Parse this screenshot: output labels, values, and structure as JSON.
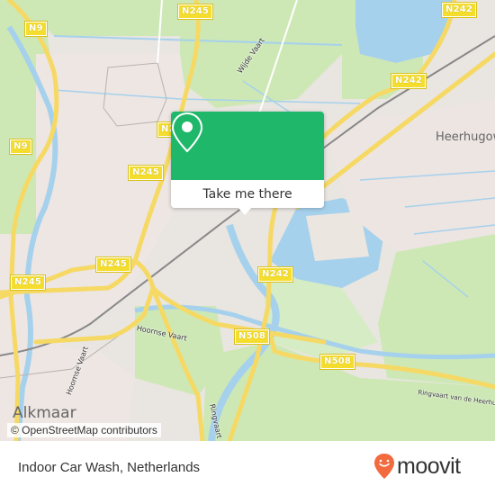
{
  "map": {
    "road_shields": [
      {
        "id": "n245-top",
        "label": "N245"
      },
      {
        "id": "n242-topright",
        "label": "N242"
      },
      {
        "id": "n9-top",
        "label": "N9"
      },
      {
        "id": "n242-mid",
        "label": "N242"
      },
      {
        "id": "n24x-partial",
        "label": "N2"
      },
      {
        "id": "n9-left",
        "label": "N9"
      },
      {
        "id": "n245-mid",
        "label": "N245"
      },
      {
        "id": "n245-left",
        "label": "N245"
      },
      {
        "id": "n245-lower",
        "label": "N245"
      },
      {
        "id": "n242-lower",
        "label": "N242"
      },
      {
        "id": "n508-a",
        "label": "N508"
      },
      {
        "id": "n508-b",
        "label": "N508"
      }
    ],
    "place_labels": {
      "alkmaar": "Alkmaar",
      "heerhugowaard": "Heerhugow"
    },
    "water_labels": {
      "wijde_vaart": "Wijde Vaart",
      "hoornse_vaart_1": "Hoornse Vaart",
      "hoornse_vaart_2": "Hoornse Vaart",
      "ringvaart_1": "Ringvaart",
      "ringvaart_2": "Ringvaart van de Heerhugowaard"
    },
    "attribution": "© OpenStreetMap contributors"
  },
  "popup": {
    "icon": "location-pin-icon",
    "button_label": "Take me there",
    "color": "#1fb86a"
  },
  "footer": {
    "location_title": "Indoor Car Wash, Netherlands",
    "brand_name": "moovit",
    "brand_color": "#f26a3d"
  }
}
